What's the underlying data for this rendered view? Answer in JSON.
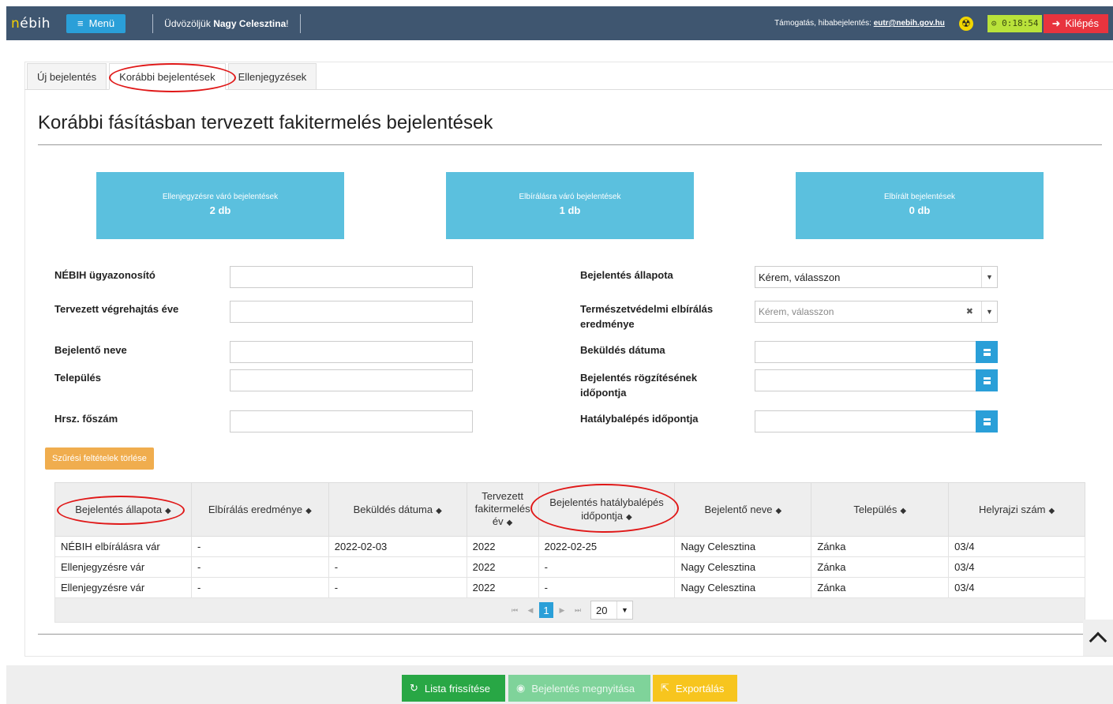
{
  "header": {
    "logo": "nébih",
    "menu_label": "Menü",
    "welcome_prefix": "Üdvözöljük",
    "user_name": "Nagy Celesztina",
    "welcome_suffix": "!",
    "support_text": "Támogatás, hibabejelentés:",
    "support_email": "eutr@nebih.gov.hu",
    "timer": "0:18:54",
    "logout_label": "Kilépés"
  },
  "tabs": [
    {
      "label": "Új bejelentés"
    },
    {
      "label": "Korábbi bejelentések",
      "active": true
    },
    {
      "label": "Ellenjegyzések"
    }
  ],
  "page_title": "Korábbi fásításban tervezett fakitermelés bejelentések",
  "stats": [
    {
      "label": "Ellenjegyzésre váró bejelentések",
      "value": "2 db"
    },
    {
      "label": "Elbírálásra váró bejelentések",
      "value": "1 db"
    },
    {
      "label": "Elbírált bejelentések",
      "value": "0 db"
    }
  ],
  "filters": {
    "case_id": "NÉBIH ügyazonosító",
    "planned_year": "Tervezett végrehajtás éve",
    "reporter_name": "Bejelentő neve",
    "settlement": "Település",
    "parcel_main": "Hrsz. főszám",
    "status": "Bejelentés állapota",
    "status_value": "Kérem, válasszon",
    "nature_result": "Természetvédelmi elbírálás eredménye",
    "nature_result_placeholder": "Kérem, válasszon",
    "sent_date": "Beküldés dátuma",
    "recorded_at": "Bejelentés rögzítésének időpontja",
    "effective_at": "Hatálybalépés időpontja",
    "clear_label": "Szűrési feltételek törlése"
  },
  "table": {
    "columns": [
      {
        "l1": "Bejelentés állapota",
        "l2": ""
      },
      {
        "l1": "Elbírálás eredménye",
        "l2": ""
      },
      {
        "l1": "Beküldés dátuma",
        "l2": ""
      },
      {
        "l1": "Tervezett",
        "l2": "fakitermelés",
        "l3": "év"
      },
      {
        "l1": "Bejelentés hatálybalépés",
        "l2": "időpontja"
      },
      {
        "l1": "Bejelentő neve",
        "l2": ""
      },
      {
        "l1": "Település",
        "l2": ""
      },
      {
        "l1": "Helyrajzi szám",
        "l2": ""
      }
    ],
    "rows": [
      [
        "NÉBIH elbírálásra vár",
        "-",
        "2022-02-03",
        "2022",
        "2022-02-25",
        "Nagy Celesztina",
        "Zánka",
        "03/4"
      ],
      [
        "Ellenjegyzésre vár",
        "-",
        "-",
        "2022",
        "-",
        "Nagy Celesztina",
        "Zánka",
        "03/4"
      ],
      [
        "Ellenjegyzésre vár",
        "-",
        "-",
        "2022",
        "-",
        "Nagy Celesztina",
        "Zánka",
        "03/4"
      ]
    ],
    "pager": {
      "current_page": "1",
      "page_size": "20"
    }
  },
  "footer": {
    "refresh_label": "Lista frissítése",
    "open_label": "Bejelentés megnyitása",
    "export_label": "Exportálás"
  },
  "colors": {
    "topbar": "#3f5670",
    "accent": "#2a9fd8",
    "stat_tile": "#5bc0de",
    "logout": "#e8343e",
    "annotation_ring": "#e01818"
  }
}
